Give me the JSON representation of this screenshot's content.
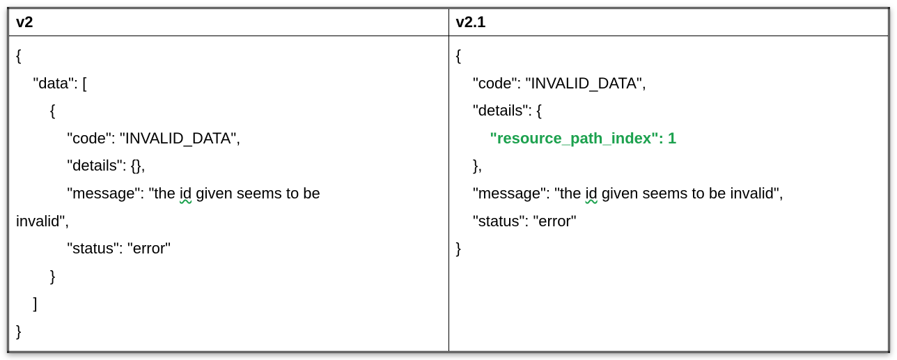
{
  "headers": {
    "left": "v2",
    "right": "v2.1"
  },
  "left_code": {
    "l1": "{",
    "l2": "    \"data\": [",
    "l3": "        {",
    "l4": "            \"code\": \"INVALID_DATA\",",
    "l5": "            \"details\": {},",
    "l6a": "            \"message\": \"the ",
    "l6_id": "id",
    "l6b": " given seems to be ",
    "l7": "invalid\",",
    "l8": "            \"status\": \"error\"",
    "l9": "        }",
    "l10": "    ]",
    "l11": "}"
  },
  "right_code": {
    "r1": "{",
    "r2": "    \"code\": \"INVALID_DATA\",",
    "r3": "    \"details\": {",
    "r4_highlight": "        \"resource_path_index\": 1",
    "r5": "    },",
    "r6a": "    \"message\": \"the ",
    "r6_id": "id",
    "r6b": " given seems to be invalid\",",
    "r7": "    \"status\": \"error\"",
    "r8": "}"
  }
}
